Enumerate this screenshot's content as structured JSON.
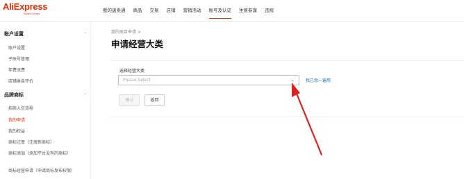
{
  "logo": {
    "main": "AliExpress",
    "sub": "Seller Center"
  },
  "nav": {
    "items": [
      "我的速卖通",
      "商品",
      "交易",
      "店铺",
      "营销活动",
      "账号及认证",
      "生意参谋",
      "违规"
    ],
    "active_index": 5
  },
  "sidebar": {
    "groups": [
      {
        "title": "账户设置",
        "toggle": "-",
        "items": [
          "账户设置",
          "子账号管理",
          "年费派费",
          "店铺类目评价"
        ]
      },
      {
        "title": "品牌商标",
        "toggle": "-",
        "items": [
          "招商入驻流程",
          "我的申请",
          "我的权益",
          "商标注册（注册新商标）",
          "商标添加（添加平台没有的商标）",
          "商标经营申请（申请商标发布权限）"
        ]
      }
    ],
    "active_item": "我的申请"
  },
  "breadcrumb": "我的类目申请 >",
  "page_title": "申请经营大类",
  "form": {
    "label": "选择经营大类",
    "select_placeholder": "Please Select",
    "chevron_icon": "chevron-down-icon",
    "link_text": "我已会一遍用",
    "confirm_label": "确认",
    "back_label": "返回"
  },
  "colors": {
    "brand": "#e62e04",
    "link": "#1a73c9",
    "annotation_arrow": "#e02020"
  }
}
